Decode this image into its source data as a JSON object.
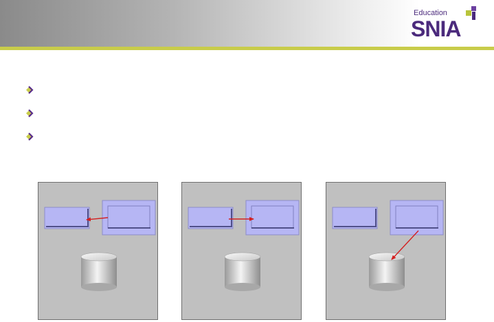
{
  "header": {
    "logo_small_text": "Education",
    "logo_large_text": "SNIA",
    "logo_color": "#4b2a7c",
    "rule_color": "#c8cc4a"
  },
  "bullets": [
    {
      "icon": "chevron-bullet-icon",
      "text": ""
    },
    {
      "icon": "chevron-bullet-icon",
      "text": ""
    },
    {
      "icon": "chevron-bullet-icon",
      "text": ""
    }
  ],
  "diagrams": [
    {
      "arrow": "right-box-to-left-box"
    },
    {
      "arrow": "left-box-to-right-box"
    },
    {
      "arrow": "right-box-to-storage"
    }
  ],
  "colors": {
    "panel_bg": "#c0c0c0",
    "box_fill": "#b6b6f4",
    "arrow": "#d42020"
  }
}
